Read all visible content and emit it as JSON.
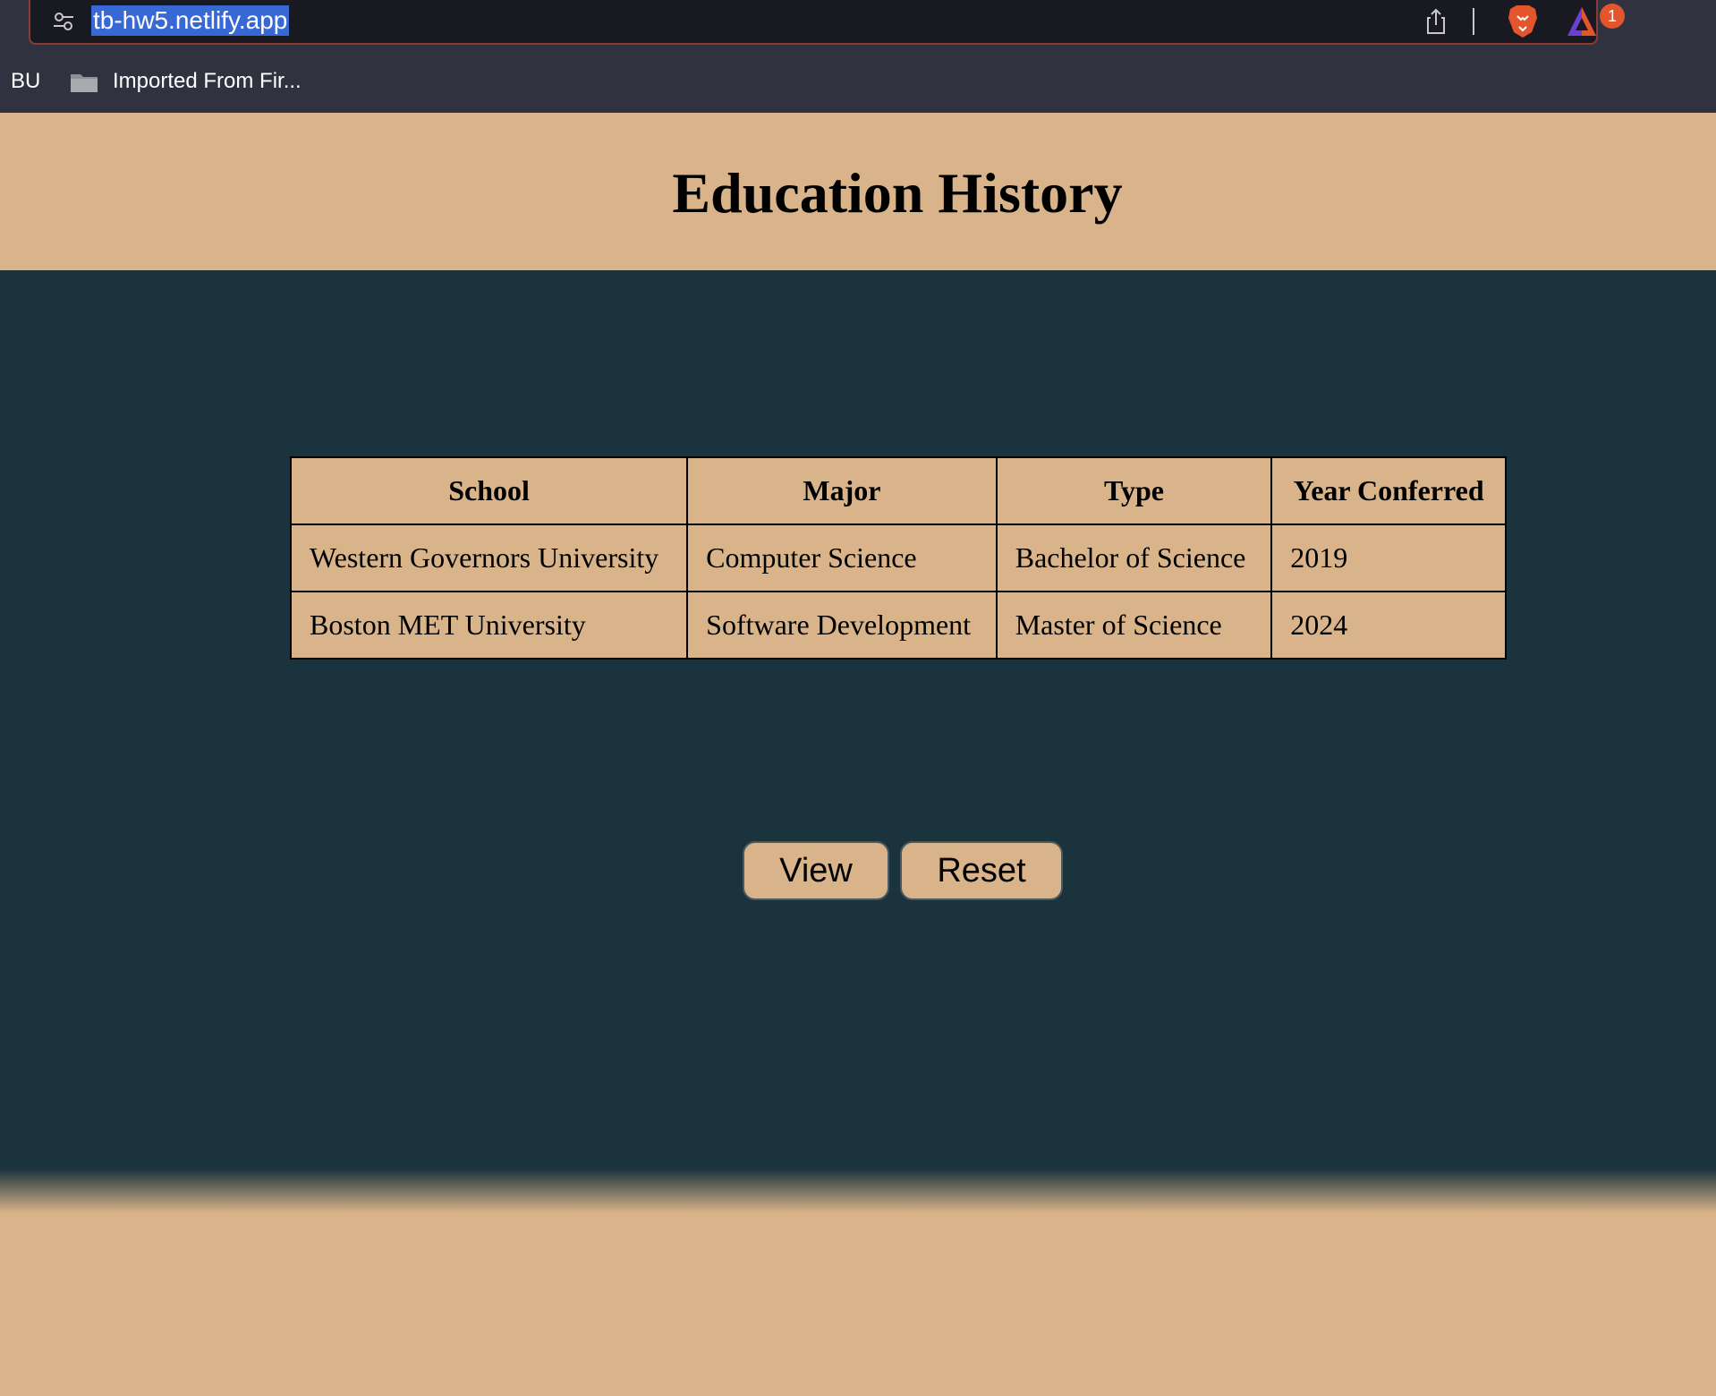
{
  "browser": {
    "url": "tb-hw5.netlify.app",
    "rewards_badge_count": "1",
    "bookmarks": [
      {
        "label": "BU"
      },
      {
        "label": "Imported From Fir..."
      }
    ]
  },
  "page": {
    "title": "Education History"
  },
  "table": {
    "headers": [
      "School",
      "Major",
      "Type",
      "Year Conferred"
    ],
    "rows": [
      [
        "Western Governors University",
        "Computer Science",
        "Bachelor of Science",
        "2019"
      ],
      [
        "Boston MET University",
        "Software Development",
        "Master of Science",
        "2024"
      ]
    ]
  },
  "actions": {
    "view_label": "View",
    "reset_label": "Reset"
  },
  "colors": {
    "tan": "#d9b48a",
    "dark_teal": "#1b333c",
    "chrome": "#31323f",
    "address_bar": "#191a21",
    "url_highlight": "#3768d4",
    "brave_orange": "#e2552d"
  },
  "icons": {
    "site_settings": "sliders-icon",
    "share": "share-icon",
    "shield": "brave-lion-icon",
    "rewards": "brave-rewards-triangle-icon",
    "folder": "folder-icon"
  }
}
